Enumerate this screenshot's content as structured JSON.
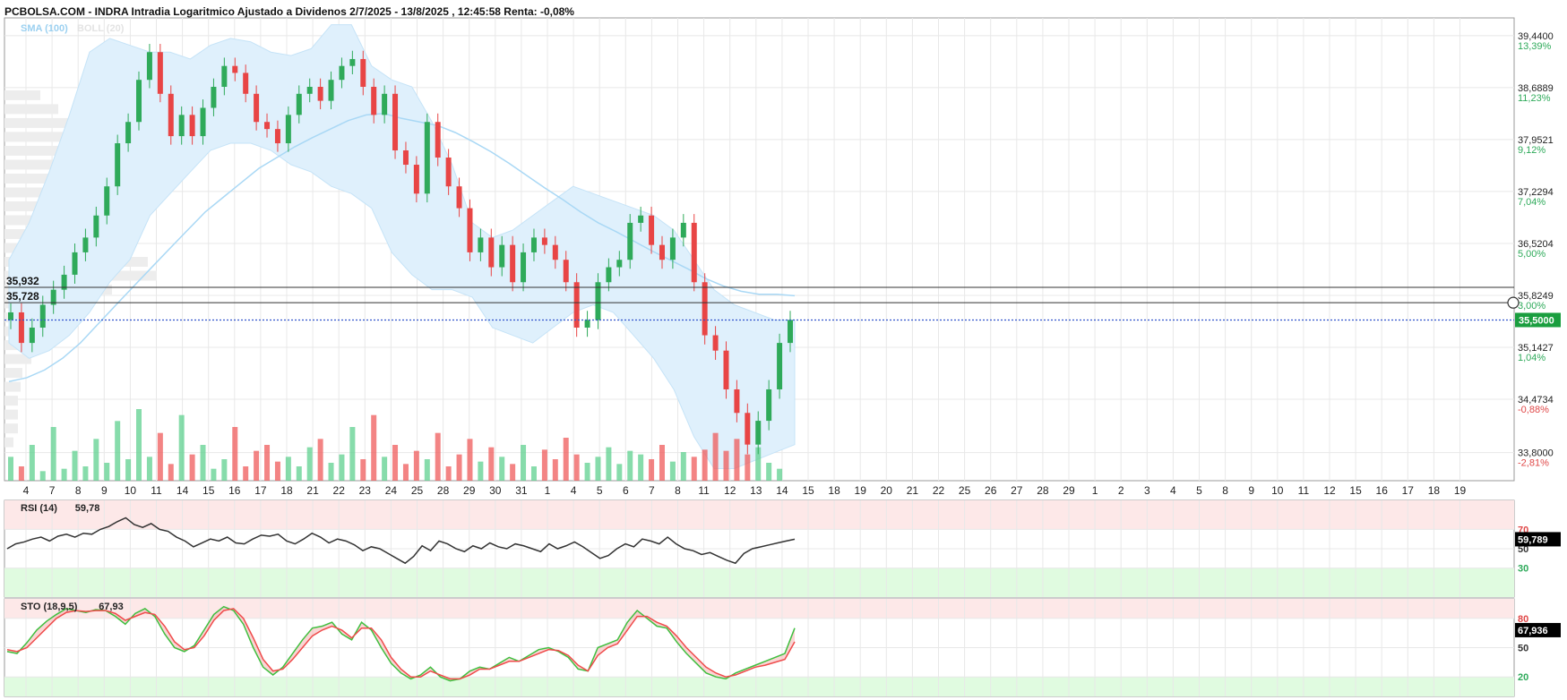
{
  "header": {
    "title": "PCBOLSA.COM - INDRA Intradia Logaritmico Ajustado a Dividenos 2/7/2025 - 13/8/2025 , 12:45:58 Renta: -0,08%"
  },
  "legend": {
    "sma": "SMA (100)",
    "boll": "BOLL (20)"
  },
  "colors": {
    "up": "#5fd08f",
    "down": "#ef5b5b",
    "band_fill": "#dff0fc",
    "sma_line": "#a9d8f5",
    "grid": "#e8e8e8",
    "current_price": "#1a9e3f",
    "hline": "#333333",
    "dotted": "#3355cc",
    "rsi_line": "#333333",
    "sto_k": "#3fbf3f",
    "sto_d": "#ef4b4b",
    "overbought_fill": "#fde8e8",
    "oversold_fill": "#e0fbe0"
  },
  "chart_data": [
    {
      "type": "candlestick",
      "log_scale": true,
      "y_range": [
        33.45,
        39.7
      ],
      "y_ticks": [
        {
          "value": 39.44,
          "label": "39,4400",
          "pct": "13,39%",
          "pct_color": "green"
        },
        {
          "value": 38.6889,
          "label": "38,6889",
          "pct": "11,23%",
          "pct_color": "green"
        },
        {
          "value": 37.9521,
          "label": "37,9521",
          "pct": "9,12%",
          "pct_color": "green"
        },
        {
          "value": 37.2294,
          "label": "37,2294",
          "pct": "7,04%",
          "pct_color": "green"
        },
        {
          "value": 36.5204,
          "label": "36,5204",
          "pct": "5,00%",
          "pct_color": "green"
        },
        {
          "value": 35.8249,
          "label": "35,8249",
          "pct": "3,00%",
          "pct_color": "green"
        },
        {
          "value": 35.1427,
          "label": "35,1427",
          "pct": "1,04%",
          "pct_color": "green"
        },
        {
          "value": 34.4734,
          "label": "34,4734",
          "pct": "-0,88%",
          "pct_color": "red"
        },
        {
          "value": 33.8,
          "label": "33,8000",
          "pct": "-2,81%",
          "pct_color": "red"
        }
      ],
      "x_labels": [
        "4",
        "7",
        "8",
        "9",
        "10",
        "11",
        "14",
        "15",
        "16",
        "17",
        "18",
        "21",
        "22",
        "23",
        "24",
        "25",
        "28",
        "29",
        "30",
        "31",
        "1",
        "4",
        "5",
        "6",
        "7",
        "8",
        "11",
        "12",
        "13",
        "14",
        "15",
        "18",
        "19",
        "20",
        "21",
        "22",
        "25",
        "26",
        "27",
        "28",
        "29",
        "1",
        "2",
        "3",
        "4",
        "5",
        "8",
        "9",
        "10",
        "11",
        "12",
        "15",
        "16",
        "17",
        "18",
        "19"
      ],
      "horizontal_lines": [
        {
          "value": 35.932,
          "label": "35,932"
        },
        {
          "value": 35.728,
          "label": "35,728"
        }
      ],
      "current_price": {
        "value": 35.5,
        "label": "35,5000"
      },
      "closes": [
        35.6,
        35.2,
        35.4,
        35.7,
        35.9,
        36.1,
        36.4,
        36.6,
        36.9,
        37.3,
        37.9,
        38.2,
        38.8,
        39.2,
        38.6,
        38.0,
        38.3,
        38.0,
        38.4,
        38.7,
        39.0,
        38.9,
        38.6,
        38.2,
        38.1,
        37.9,
        38.3,
        38.6,
        38.7,
        38.5,
        38.8,
        39.0,
        39.1,
        38.7,
        38.3,
        38.6,
        37.8,
        37.6,
        37.2,
        38.2,
        37.7,
        37.3,
        37.0,
        36.4,
        36.6,
        36.2,
        36.5,
        36.0,
        36.4,
        36.6,
        36.5,
        36.3,
        36.0,
        35.4,
        35.5,
        36.0,
        36.2,
        36.3,
        36.8,
        36.9,
        36.5,
        36.3,
        36.6,
        36.8,
        36.0,
        35.3,
        35.1,
        34.6,
        34.3,
        33.9,
        34.2,
        34.6,
        35.2,
        35.5
      ],
      "sma": [
        34.7,
        34.75,
        34.85,
        35.0,
        35.2,
        35.45,
        35.7,
        35.95,
        36.2,
        36.45,
        36.7,
        36.95,
        37.15,
        37.35,
        37.55,
        37.7,
        37.85,
        37.98,
        38.1,
        38.22,
        38.3,
        38.32,
        38.25,
        38.2,
        38.15,
        38.05,
        37.92,
        37.78,
        37.62,
        37.45,
        37.28,
        37.12,
        36.95,
        36.8,
        36.68,
        36.55,
        36.42,
        36.3,
        36.18,
        36.05,
        35.95,
        35.88,
        35.84,
        35.84,
        35.82
      ],
      "boll_upper": [
        36.3,
        36.8,
        37.5,
        38.3,
        39.2,
        39.4,
        39.3,
        39.2,
        39.2,
        39.1,
        39.3,
        39.4,
        39.35,
        39.2,
        39.15,
        39.25,
        39.6,
        39.6,
        39.0,
        38.8,
        38.7,
        38.2,
        37.6,
        36.8,
        36.6,
        36.7,
        36.9,
        37.1,
        37.3,
        37.2,
        37.1,
        37.0,
        36.9,
        36.7,
        36.3,
        35.9,
        35.7,
        35.6,
        35.5,
        35.5
      ],
      "boll_lower": [
        35.2,
        35.0,
        35.1,
        35.3,
        35.6,
        36.0,
        36.3,
        36.9,
        37.2,
        37.5,
        37.8,
        37.9,
        37.9,
        37.8,
        37.6,
        37.5,
        37.3,
        37.2,
        37.0,
        36.4,
        36.1,
        35.9,
        35.9,
        35.8,
        35.4,
        35.3,
        35.2,
        35.4,
        35.6,
        35.7,
        35.6,
        35.3,
        35.0,
        34.6,
        34.0,
        33.6,
        33.6,
        33.7,
        33.8,
        33.9
      ],
      "volumes": [
        20,
        12,
        30,
        8,
        45,
        10,
        25,
        12,
        35,
        15,
        50,
        18,
        60,
        20,
        40,
        14,
        55,
        22,
        30,
        10,
        18,
        45,
        12,
        25,
        30,
        16,
        20,
        12,
        28,
        35,
        15,
        22,
        45,
        18,
        55,
        20,
        30,
        14,
        25,
        18,
        40,
        12,
        22,
        35,
        16,
        28,
        20,
        14,
        30,
        12,
        26,
        18,
        36,
        22,
        15,
        20,
        28,
        14,
        25,
        22,
        18,
        30,
        16,
        24,
        20,
        26,
        40,
        25,
        35,
        22,
        28,
        15,
        10
      ]
    },
    {
      "type": "line",
      "name": "RSI (14)",
      "header_value": "59,78",
      "y_range": [
        0,
        100
      ],
      "levels": [
        {
          "value": 70,
          "label": "70",
          "color": "red"
        },
        {
          "value": 50,
          "label": "50",
          "color": "gray"
        },
        {
          "value": 30,
          "label": "30",
          "color": "green"
        }
      ],
      "current": {
        "value": 59.789,
        "label": "59,789"
      },
      "values": [
        50,
        55,
        57,
        60,
        62,
        58,
        63,
        65,
        62,
        66,
        65,
        70,
        73,
        78,
        82,
        75,
        72,
        76,
        70,
        68,
        62,
        58,
        52,
        56,
        60,
        58,
        62,
        56,
        55,
        60,
        64,
        63,
        65,
        58,
        55,
        60,
        66,
        62,
        56,
        60,
        58,
        54,
        48,
        52,
        50,
        45,
        40,
        35,
        42,
        53,
        48,
        58,
        55,
        50,
        47,
        53,
        50,
        56,
        52,
        50,
        55,
        53,
        50,
        47,
        55,
        50,
        53,
        57,
        52,
        46,
        40,
        43,
        50,
        55,
        52,
        60,
        58,
        55,
        62,
        55,
        50,
        48,
        44,
        46,
        42,
        38,
        35,
        45,
        50,
        52,
        54,
        56,
        58,
        59.8
      ]
    },
    {
      "type": "line",
      "name": "STO (18,9,5)",
      "header_value": "67,93",
      "y_range": [
        0,
        100
      ],
      "levels": [
        {
          "value": 80,
          "label": "80",
          "color": "red"
        },
        {
          "value": 50,
          "label": "50",
          "color": "gray"
        },
        {
          "value": 20,
          "label": "20",
          "color": "green"
        }
      ],
      "current": {
        "value": 67.936,
        "label": "67,936"
      },
      "k": [
        46,
        44,
        55,
        68,
        77,
        84,
        90,
        88,
        86,
        89,
        88,
        82,
        74,
        85,
        90,
        82,
        64,
        50,
        46,
        52,
        68,
        84,
        92,
        88,
        74,
        50,
        30,
        22,
        30,
        44,
        58,
        70,
        72,
        76,
        64,
        58,
        76,
        68,
        50,
        34,
        24,
        18,
        22,
        30,
        20,
        16,
        18,
        26,
        30,
        28,
        34,
        40,
        36,
        42,
        48,
        50,
        46,
        40,
        28,
        26,
        50,
        54,
        58,
        76,
        88,
        80,
        72,
        70,
        56,
        44,
        34,
        24,
        20,
        18,
        24,
        28,
        32,
        36,
        40,
        44,
        70
      ],
      "d": [
        48,
        46,
        50,
        60,
        70,
        80,
        86,
        88,
        87,
        88,
        88,
        85,
        78,
        82,
        86,
        84,
        72,
        56,
        48,
        50,
        62,
        78,
        88,
        90,
        80,
        60,
        38,
        26,
        28,
        38,
        50,
        62,
        68,
        72,
        68,
        60,
        70,
        70,
        58,
        40,
        28,
        20,
        20,
        26,
        22,
        18,
        18,
        22,
        28,
        28,
        32,
        36,
        36,
        40,
        44,
        48,
        47,
        42,
        32,
        26,
        42,
        50,
        54,
        68,
        82,
        82,
        76,
        72,
        62,
        50,
        40,
        30,
        24,
        20,
        22,
        26,
        30,
        32,
        35,
        38,
        56
      ]
    }
  ]
}
